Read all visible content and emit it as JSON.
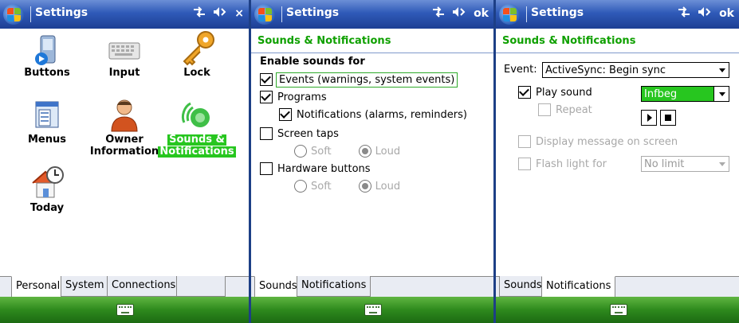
{
  "screens": [
    {
      "title": "Settings",
      "right_action": "×",
      "grid": [
        {
          "label_lines": [
            "Buttons"
          ],
          "icon": "buttons-icon"
        },
        {
          "label_lines": [
            "Input"
          ],
          "icon": "keyboard-icon"
        },
        {
          "label_lines": [
            "Lock"
          ],
          "icon": "key-icon"
        },
        {
          "label_lines": [
            "Menus"
          ],
          "icon": "menus-icon"
        },
        {
          "label_lines": [
            "Owner",
            "Information"
          ],
          "icon": "owner-icon"
        },
        {
          "label_lines": [
            "Sounds &",
            "Notifications"
          ],
          "icon": "sounds-icon",
          "selected": true
        },
        {
          "label_lines": [
            "Today"
          ],
          "icon": "today-icon"
        }
      ],
      "tabs": [
        "Personal",
        "System",
        "Connections"
      ],
      "active_tab": "Personal"
    },
    {
      "title": "Settings",
      "right_action": "ok",
      "header": "Sounds & Notifications",
      "enable_label": "Enable sounds for",
      "events_label": "Events (warnings, system events)",
      "events_checked": true,
      "programs_label": "Programs",
      "programs_checked": true,
      "notifications_label": "Notifications (alarms, reminders)",
      "notifications_checked": true,
      "screen_taps_label": "Screen taps",
      "screen_taps_checked": false,
      "screen_taps_options": {
        "soft": "Soft",
        "loud": "Loud",
        "selected": "Loud"
      },
      "hardware_label": "Hardware buttons",
      "hardware_checked": false,
      "hardware_options": {
        "soft": "Soft",
        "loud": "Loud",
        "selected": "Loud"
      },
      "tabs": [
        "Sounds",
        "Notifications"
      ],
      "active_tab": "Sounds"
    },
    {
      "title": "Settings",
      "right_action": "ok",
      "header": "Sounds & Notifications",
      "event_label": "Event:",
      "event_value": "ActiveSync: Begin sync",
      "play_sound_label": "Play sound",
      "play_sound_checked": true,
      "sound_value": "Infbeg",
      "repeat_label": "Repeat",
      "display_message_label": "Display message on screen",
      "flash_light_label": "Flash light for",
      "flash_light_value": "No limit",
      "tabs": [
        "Sounds",
        "Notifications"
      ],
      "active_tab": "Notifications"
    }
  ],
  "colors": {
    "accent_green": "#27c61f",
    "header_green": "#0fa000",
    "titlebar_blue": "#2f5ab8",
    "softkey_green": "#2e8a1d"
  }
}
